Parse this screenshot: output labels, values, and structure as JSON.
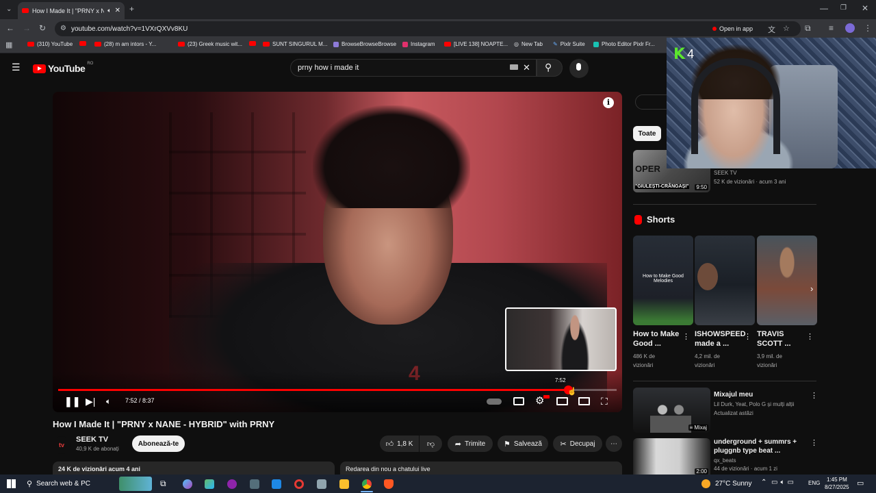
{
  "browser": {
    "tab_title": "How I Made It | \"PRNY x N...",
    "url": "youtube.com/watch?v=1VXrQXVv8KU",
    "open_in_app": "Open in app",
    "bookmarks": [
      "(310) YouTube",
      "(28) m am intors - Y...",
      "(23) Greek music wit...",
      "SUNT SINGURUL M...",
      "BrowseBrowseBrowse",
      "Instagram",
      "[LIVE 138] NOAPTE...",
      "New Tab",
      "Pixlr Suite",
      "Photo Editor Pixlr Fr..."
    ]
  },
  "youtube": {
    "logo": "YouTube",
    "logo_region": "RO",
    "search_value": "prny how i made it"
  },
  "player": {
    "time": "7:52 / 8:37",
    "preview_time": "7:52",
    "progress_fraction": 0.913,
    "watermark": "4"
  },
  "video": {
    "title": "How I Made It | \"PRNY x NANE - HYBRID\" with PRNY",
    "channel": "SEEK TV",
    "channel_logo": "tv",
    "subscribers": "40,9 K de abonați",
    "subscribe": "Abonează-te",
    "likes": "1,8 K",
    "share": "Trimite",
    "save": "Salvează",
    "clip": "Decupaj",
    "views_info": "24 K de vizionări  acum 4 ani",
    "live_chat": "Redarea din nou a chatului live"
  },
  "sidebar": {
    "filter_all": "Toate",
    "top_video": {
      "thumb_text": "\"GIULEȘTI-CRÂNGAȘI\"",
      "thumb_sign": "OPER",
      "duration": "9:50",
      "channel": "SEEK TV",
      "meta": "52 K de vizionări · acum 3 ani"
    },
    "shorts_heading": "Shorts",
    "shorts": [
      {
        "title": "How to Make Good ...",
        "views": "486 K de vizionări",
        "thumb_text": "How to Make Good Melodies"
      },
      {
        "title": "ISHOWSPEED made a ...",
        "views": "4,2 mil. de vizionări",
        "thumb_text": ""
      },
      {
        "title": "TRAVIS SCOTT ...",
        "views": "3,9 mil. de vizionări",
        "thumb_text": ""
      }
    ],
    "mix": {
      "title": "Mixajul meu",
      "subtitle": "Lil Durk, Yeat, Polo G și mulți alții",
      "meta": "Actualizat astăzi",
      "badge": "Mixaj"
    },
    "next": {
      "title": "underground + summrs + pluggnb type beat ...",
      "channel": "qx_beats",
      "meta": "44 de vizionări · acum 1 zi",
      "duration": "2:00"
    }
  },
  "webcam": {
    "logo_letter": "K",
    "logo_number": "4"
  },
  "taskbar": {
    "search_placeholder": "Search web & PC",
    "weather": "27°C  Sunny",
    "lang": "ENG",
    "time": "1:45 PM",
    "date": "8/27/2025"
  },
  "colors": {
    "accent": "#ff0000",
    "background": "#0f0f0f"
  }
}
